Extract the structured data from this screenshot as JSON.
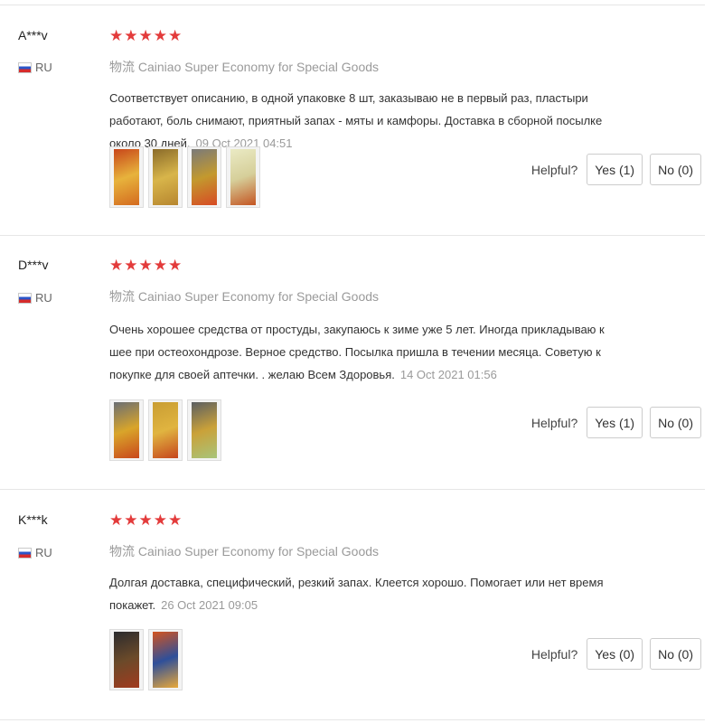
{
  "reviews": [
    {
      "username": "A***v",
      "country": "RU",
      "rating": 5,
      "logistics": "物流 Cainiao Super Economy for Special Goods",
      "text": "Соответствует описанию, в одной упаковке 8 шт, заказываю не в первый раз, пластыри работают, боль снимают, приятный запах - мяты и камфоры. Доставка в сборной посылке около 30 дней.",
      "date": "09 Oct 2021 04:51",
      "images": [
        {
          "colors": [
            "#c8461a",
            "#e7b33c",
            "#d46a1f"
          ]
        },
        {
          "colors": [
            "#8a6b2a",
            "#d8b54a",
            "#b7862f"
          ]
        },
        {
          "colors": [
            "#7a7a7a",
            "#c3992e",
            "#d74a24"
          ]
        },
        {
          "colors": [
            "#eaeac4",
            "#d6cf9a",
            "#c45522"
          ]
        }
      ],
      "helpful_label": "Helpful?",
      "yes_label": "Yes (1)",
      "no_label": "No (0)"
    },
    {
      "username": "D***v",
      "country": "RU",
      "rating": 5,
      "logistics": "物流 Cainiao Super Economy for Special Goods",
      "text": "Очень хорошее средства от простуды, закупаюсь к зиме уже 5 лет. Иногда прикладываю к шее при остеохондрозе. Верное средство. Посылка пришла в течении месяца. Советую к покупке для своей аптечки. . желаю Всем Здоровья.",
      "date": "14 Oct 2021 01:56",
      "images": [
        {
          "colors": [
            "#6a6e74",
            "#d9a52a",
            "#c9471c"
          ]
        },
        {
          "colors": [
            "#c99d33",
            "#e0b440",
            "#c6461d"
          ]
        },
        {
          "colors": [
            "#5b5f63",
            "#caa139",
            "#a8c47a"
          ]
        }
      ],
      "helpful_label": "Helpful?",
      "yes_label": "Yes (1)",
      "no_label": "No (0)"
    },
    {
      "username": "K***k",
      "country": "RU",
      "rating": 5,
      "logistics": "物流 Cainiao Super Economy for Special Goods",
      "text": "Долгая доставка, специфический, резкий запах. Клеется хорошо. Помогает или нет время покажет.",
      "date": "26 Oct 2021 09:05",
      "images": [
        {
          "colors": [
            "#2b2b2e",
            "#6b4a2a",
            "#a13a1e"
          ]
        },
        {
          "colors": [
            "#d3541f",
            "#2e4f9a",
            "#e8a83a"
          ]
        }
      ],
      "helpful_label": "Helpful?",
      "yes_label": "Yes (0)",
      "no_label": "No (0)"
    }
  ],
  "colors": {
    "star": "#e33b3b",
    "muted_text": "#9a9a9a",
    "divider": "#e6e6e6",
    "button_border": "#cccccc"
  }
}
